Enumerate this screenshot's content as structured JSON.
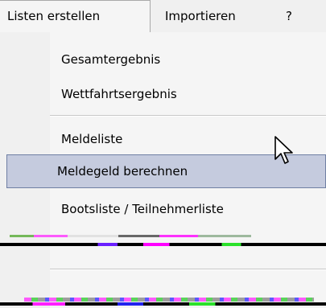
{
  "menubar": {
    "listen": "Listen erstellen",
    "importieren": "Importieren",
    "help": "?"
  },
  "dropdown": {
    "items": [
      "Gesamtergebnis",
      "Wettfahrtsergebnis",
      "Meldeliste",
      "Meldegeld berechnen",
      "Bootsliste / Teilnehmerliste"
    ],
    "highlighted_index": 3
  },
  "colors": {
    "highlight_fill": "#c5cbde",
    "highlight_border": "#6f7fa3"
  },
  "icons": {
    "cursor": "mouse-pointer-icon"
  }
}
